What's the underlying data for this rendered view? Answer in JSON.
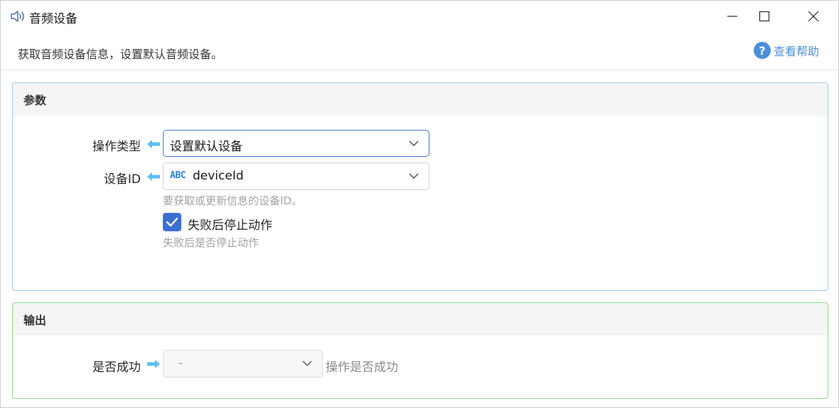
{
  "window": {
    "title": "音频设备",
    "title_icon": "speaker-icon",
    "controls": [
      "minimize-icon",
      "maximize-icon",
      "close-icon"
    ]
  },
  "description": {
    "text": "获取音频设备信息，设置默认音频设备。",
    "help_label": "查看帮助",
    "help_icon": "question-circle-icon"
  },
  "params": {
    "title": "参数",
    "operation_type": {
      "label": "操作类型",
      "value": "设置默认设备"
    },
    "device_id": {
      "label": "设备ID",
      "type_badge": "ABC",
      "value": "deviceId",
      "hint": "要获取或更新信息的设备ID。"
    },
    "stop_on_fail": {
      "label": "失败后停止动作",
      "checked": true,
      "hint": "失败后是否停止动作"
    }
  },
  "output": {
    "title": "输出",
    "success": {
      "label": "是否成功",
      "value": "-",
      "description": "操作是否成功"
    }
  },
  "colors": {
    "accent": "#3d6fd1",
    "link": "#4a8fd9",
    "params_border": "#9cc8ee",
    "output_border": "#8bd98b",
    "arrow": "#5bbfef"
  }
}
